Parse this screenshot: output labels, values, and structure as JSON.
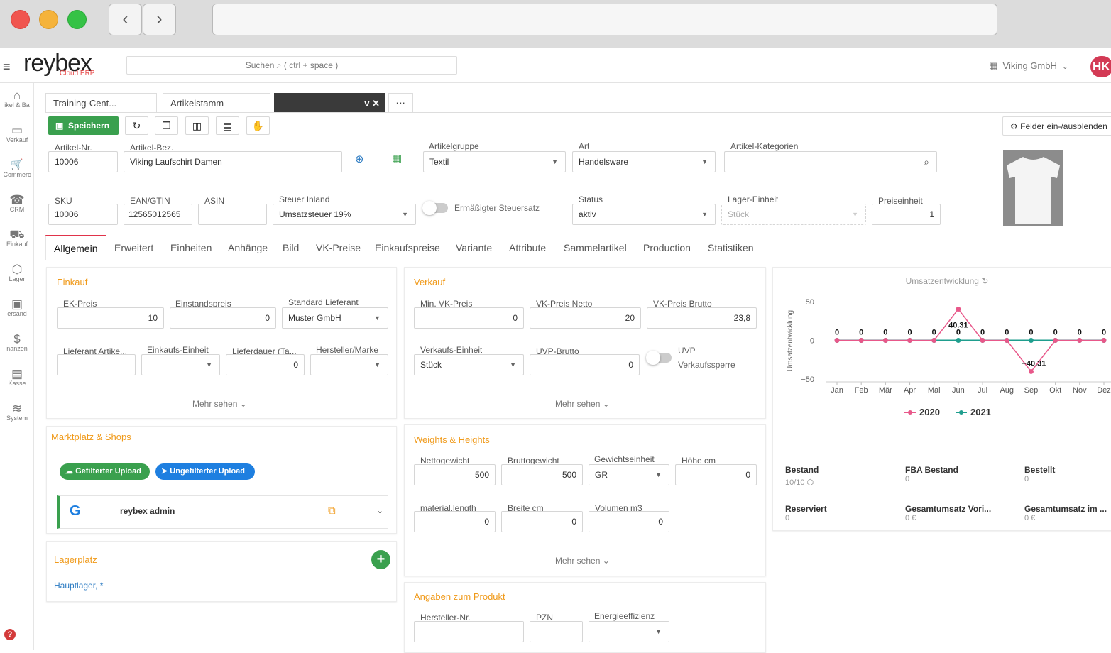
{
  "browser": {
    "back": "‹",
    "forward": "›"
  },
  "app": {
    "logo": "reybex",
    "logo_sub": "Cloud ERP",
    "search_label": "Suchen",
    "search_hint": "( ctrl + space )",
    "company": "Viking GmbH",
    "avatar": "HK"
  },
  "sidebar": [
    {
      "label": "ikel & Ba",
      "icon": "home-icon",
      "glyph": "⌂"
    },
    {
      "label": "Verkauf",
      "icon": "invoice-icon",
      "glyph": "▭"
    },
    {
      "label": "Commerc",
      "icon": "cart-icon",
      "glyph": "🛒"
    },
    {
      "label": "CRM",
      "icon": "phone-icon",
      "glyph": "☎"
    },
    {
      "label": "Einkauf",
      "icon": "truck-icon",
      "glyph": "⛟"
    },
    {
      "label": "Lager",
      "icon": "box-icon",
      "glyph": "⬡"
    },
    {
      "label": "ersand",
      "icon": "package-icon",
      "glyph": "▣"
    },
    {
      "label": "nanzen",
      "icon": "dollar-icon",
      "glyph": "$"
    },
    {
      "label": "Kasse",
      "icon": "register-icon",
      "glyph": "▤"
    },
    {
      "label": "System",
      "icon": "database-icon",
      "glyph": "≋"
    }
  ],
  "doc_tabs": [
    {
      "label": "Training-Cent..."
    },
    {
      "label": "Artikelstamm"
    },
    {
      "label": "v ✕"
    }
  ],
  "toolbar": {
    "more": "···",
    "save": "Speichern",
    "reload": "↻",
    "copy": "❐",
    "report": "▥",
    "doc": "▤",
    "hand": "✋",
    "felder": "Felder ein-/ausblenden"
  },
  "header_fields": {
    "artikel_nr": {
      "label": "Artikel-Nr.",
      "value": "10006"
    },
    "artikel_bez": {
      "label": "Artikel-Bez.",
      "value": "Viking Laufschirt Damen"
    },
    "artikelgruppe": {
      "label": "Artikelgruppe",
      "value": "Textil"
    },
    "art": {
      "label": "Art",
      "value": "Handelsware"
    },
    "kategorien": {
      "label": "Artikel-Kategorien",
      "value": ""
    },
    "sku": {
      "label": "SKU",
      "value": "10006"
    },
    "ean": {
      "label": "EAN/GTIN",
      "value": "12565012565"
    },
    "asin": {
      "label": "ASIN",
      "value": ""
    },
    "steuer": {
      "label": "Steuer Inland",
      "value": "Umsatzsteuer 19%"
    },
    "ermaessigt": {
      "label": "Ermäßigter Steuersatz"
    },
    "status": {
      "label": "Status",
      "value": "aktiv"
    },
    "lager_einheit": {
      "label": "Lager-Einheit",
      "value": "Stück"
    },
    "preiseinheit": {
      "label": "Preiseinheit",
      "value": "1"
    }
  },
  "nav_tabs": [
    "Allgemein",
    "Erweitert",
    "Einheiten",
    "Anhänge",
    "Bild",
    "VK-Preise",
    "Einkaufspreise",
    "Variante",
    "Attribute",
    "Sammelartikel",
    "Production",
    "Statistiken"
  ],
  "einkauf": {
    "title": "Einkauf",
    "ek_preis": {
      "label": "EK-Preis",
      "value": "10"
    },
    "einstandspreis": {
      "label": "Einstandspreis",
      "value": "0"
    },
    "standard_lieferant": {
      "label": "Standard Lieferant",
      "value": "Muster GmbH"
    },
    "lieferant_artikel": {
      "label": "Lieferant Artike...",
      "value": ""
    },
    "einkaufs_einheit": {
      "label": "Einkaufs-Einheit",
      "value": ""
    },
    "lieferdauer": {
      "label": "Lieferdauer (Ta...",
      "value": "0"
    },
    "hersteller_marke": {
      "label": "Hersteller/Marke",
      "value": ""
    },
    "mehr": "Mehr sehen ⌄"
  },
  "verkauf": {
    "title": "Verkauf",
    "min_vk": {
      "label": "Min. VK-Preis",
      "value": "0"
    },
    "vk_netto": {
      "label": "VK-Preis Netto",
      "value": "20"
    },
    "vk_brutto": {
      "label": "VK-Preis Brutto",
      "value": "23,8"
    },
    "verkaufs_einheit": {
      "label": "Verkaufs-Einheit",
      "value": "Stück"
    },
    "uvp_brutto": {
      "label": "UVP-Brutto",
      "value": "0"
    },
    "uvp_sperre": {
      "label1": "UVP",
      "label2": "Verkaufssperre"
    },
    "mehr": "Mehr sehen ⌄"
  },
  "marktplatz": {
    "title": "Marktplatz & Shops",
    "gefiltert": "Gefilterter Upload",
    "ungefiltert": "Ungefilterter Upload",
    "shop_name": "reybex admin"
  },
  "lagerplatz": {
    "title": "Lagerplatz",
    "entry": "Hauptlager, *",
    "add": "+"
  },
  "weights": {
    "title": "Weights & Heights",
    "nettogewicht": {
      "label": "Nettogewicht",
      "value": "500"
    },
    "bruttogewicht": {
      "label": "Bruttogewicht",
      "value": "500"
    },
    "gewichtseinheit": {
      "label": "Gewichtseinheit",
      "value": "GR"
    },
    "hoehe": {
      "label": "Höhe cm",
      "value": "0"
    },
    "length": {
      "label": "material.length",
      "value": "0"
    },
    "breite": {
      "label": "Breite cm",
      "value": "0"
    },
    "volumen": {
      "label": "Volumen m3",
      "value": "0"
    },
    "mehr": "Mehr sehen ⌄"
  },
  "produkt": {
    "title": "Angaben zum Produkt",
    "hersteller_nr": {
      "label": "Hersteller-Nr.",
      "value": ""
    },
    "pzn": {
      "label": "PZN",
      "value": ""
    },
    "energie": {
      "label": "Energieeffizienz",
      "value": ""
    }
  },
  "stats": {
    "bestand": {
      "label": "Bestand",
      "value": "10/10"
    },
    "fba": {
      "label": "FBA Bestand",
      "value": "0"
    },
    "bestellt": {
      "label": "Bestellt",
      "value": "0"
    },
    "reserviert": {
      "label": "Reserviert",
      "value": "0"
    },
    "umsatz_vorj": {
      "label": "Gesamtumsatz Vori...",
      "value": "0 €"
    },
    "umsatz_im": {
      "label": "Gesamtumsatz im ...",
      "value": "0 €"
    }
  },
  "colors": {
    "save_green": "#3aa04e",
    "accent_orange": "#f09a1a",
    "series_2020": "#e8588a",
    "series_2021": "#1f9e8e",
    "upload_blue": "#1e7fe0"
  },
  "chart_data": {
    "type": "line",
    "title": "Umsatzentwicklung",
    "ylabel": "Umsatzentwicklung",
    "xlabel": "",
    "categories": [
      "Jan",
      "Feb",
      "Mär",
      "Apr",
      "Mai",
      "Jun",
      "Jul",
      "Aug",
      "Sep",
      "Okt",
      "Nov",
      "Dez"
    ],
    "ylim": [
      -50,
      50
    ],
    "yticks": [
      50,
      0,
      -50
    ],
    "legend": "bottom",
    "series": [
      {
        "name": "2020",
        "values": [
          0,
          0,
          0,
          0,
          0,
          40.31,
          0,
          0,
          -40.31,
          0,
          0,
          0
        ]
      },
      {
        "name": "2021",
        "values": [
          0,
          0,
          0,
          0,
          0,
          0,
          0,
          0,
          0,
          0,
          0,
          0
        ]
      }
    ],
    "labels": [
      "0",
      "0",
      "0",
      "0",
      "0",
      "40.31",
      "0",
      "0",
      "0",
      "0",
      "−40.31",
      "0",
      "0",
      "0",
      "0"
    ]
  }
}
